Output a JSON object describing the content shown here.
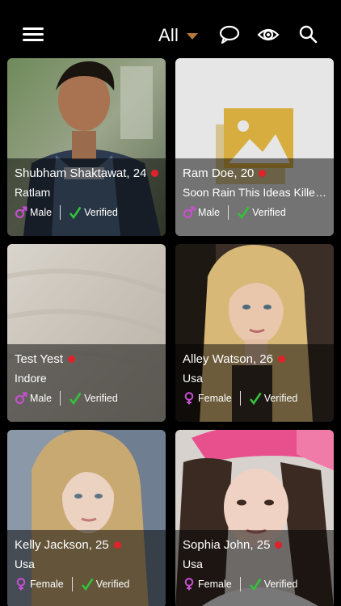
{
  "header": {
    "filter_label": "All",
    "icons": [
      "menu-icon",
      "chat-icon",
      "eye-icon",
      "search-icon"
    ]
  },
  "colors": {
    "background": "#000000",
    "caret": "#b7793a",
    "online": "#e0222b",
    "gender": "#c94fd4",
    "verified": "#35c23a"
  },
  "profiles": [
    {
      "name": "Shubham Shaktawat, 24",
      "city": "Ratlam",
      "gender": "Male",
      "verified": "Verified",
      "photo": "man-portrait"
    },
    {
      "name": "Ram Doe, 20",
      "city": "Soon Rain This Ideas Killed...",
      "gender": "Male",
      "verified": "Verified",
      "photo": "placeholder-image"
    },
    {
      "name": "Test Yest",
      "city": "Indore",
      "gender": "Male",
      "verified": "Verified",
      "photo": "fabric-texture"
    },
    {
      "name": "Alley Watson, 26",
      "city": "Usa",
      "gender": "Female",
      "verified": "Verified",
      "photo": "woman-portrait"
    },
    {
      "name": "Kelly Jackson, 25",
      "city": "Usa",
      "gender": "Female",
      "verified": "Verified",
      "photo": "woman-portrait"
    },
    {
      "name": "Sophia John, 25",
      "city": "Usa",
      "gender": "Female",
      "verified": "Verified",
      "photo": "woman-pink-cap-portrait"
    }
  ]
}
